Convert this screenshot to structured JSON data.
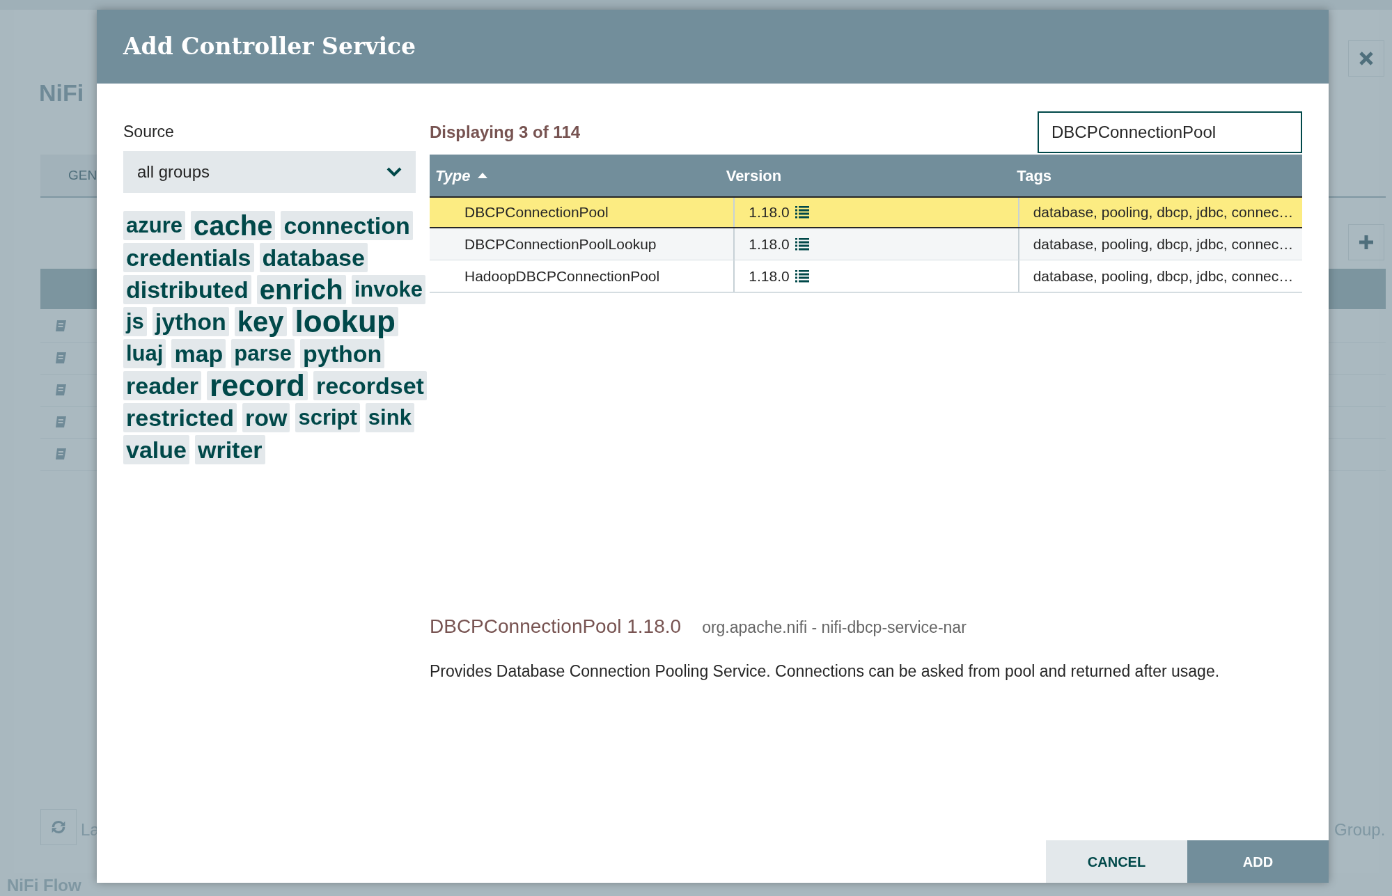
{
  "background": {
    "title": "NiFi",
    "tab": "GEN",
    "refresh_label": "La",
    "breadcrumb": "NiFi Flow",
    "footer_text": "Group."
  },
  "dialog": {
    "title": "Add Controller Service"
  },
  "source": {
    "label": "Source",
    "value": "all groups"
  },
  "tags": [
    {
      "label": "azure",
      "kind": "small"
    },
    {
      "label": "cache",
      "kind": "large"
    },
    {
      "label": "connection",
      "kind": "medium"
    },
    {
      "label": "credentials",
      "kind": "medium"
    },
    {
      "label": "database",
      "kind": "medium"
    },
    {
      "label": "distributed",
      "kind": "medium"
    },
    {
      "label": "enrich",
      "kind": "large"
    },
    {
      "label": "invoke",
      "kind": "small"
    },
    {
      "label": "js",
      "kind": "small"
    },
    {
      "label": "jython",
      "kind": "medium"
    },
    {
      "label": "key",
      "kind": "large"
    },
    {
      "label": "lookup",
      "kind": "xlarge"
    },
    {
      "label": "luaj",
      "kind": "small"
    },
    {
      "label": "map",
      "kind": "medium"
    },
    {
      "label": "parse",
      "kind": "small"
    },
    {
      "label": "python",
      "kind": "medium"
    },
    {
      "label": "reader",
      "kind": "medium"
    },
    {
      "label": "record",
      "kind": "xlarge"
    },
    {
      "label": "recordset",
      "kind": "medium"
    },
    {
      "label": "restricted",
      "kind": "medium"
    },
    {
      "label": "row",
      "kind": "medium"
    },
    {
      "label": "script",
      "kind": "small"
    },
    {
      "label": "sink",
      "kind": "small"
    },
    {
      "label": "value",
      "kind": "medium"
    },
    {
      "label": "writer",
      "kind": "medium"
    }
  ],
  "status": "Displaying 3 of 114",
  "search": {
    "value": "DBCPConnectionPool"
  },
  "table": {
    "columns": [
      {
        "label": "Type",
        "sorted": true
      },
      {
        "label": "Version",
        "sorted": false
      },
      {
        "label": "Tags",
        "sorted": false
      }
    ],
    "rows": [
      {
        "type": "DBCPConnectionPool",
        "version": "1.18.0",
        "tags": "database, pooling, dbcp, jdbc, connec…",
        "selected": true
      },
      {
        "type": "DBCPConnectionPoolLookup",
        "version": "1.18.0",
        "tags": "database, pooling, dbcp, jdbc, connec…",
        "selected": false
      },
      {
        "type": "HadoopDBCPConnectionPool",
        "version": "1.18.0",
        "tags": "database, pooling, dbcp, jdbc, connec…",
        "selected": false
      }
    ]
  },
  "details": {
    "title": "DBCPConnectionPool 1.18.0",
    "bundle": "org.apache.nifi - nifi-dbcp-service-nar",
    "description": "Provides Database Connection Pooling Service. Connections can be asked from pool and returned after usage."
  },
  "buttons": [
    {
      "label": "CANCEL",
      "kind": "secondary"
    },
    {
      "label": "ADD",
      "kind": "primary"
    }
  ]
}
